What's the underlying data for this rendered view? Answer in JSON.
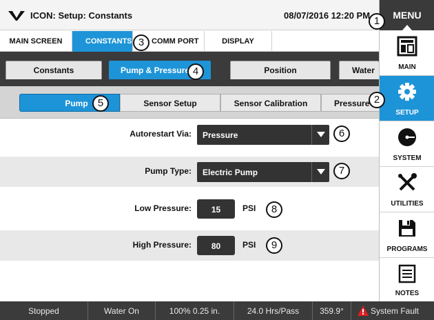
{
  "window": {
    "title": "ICON: Setup: Constants",
    "datetime": "08/07/2016 12:20 PM",
    "menu_label": "MENU"
  },
  "top_tabs": [
    {
      "label": "MAIN SCREEN",
      "active": false
    },
    {
      "label": "CONSTANTS",
      "active": true
    },
    {
      "label": "COMM PORT",
      "active": false
    },
    {
      "label": "DISPLAY",
      "active": false
    }
  ],
  "sub_tabs": [
    {
      "label": "Constants",
      "active": false
    },
    {
      "label": "Pump & Pressure",
      "active": true
    },
    {
      "label": "Position",
      "active": false
    },
    {
      "label": "Water",
      "active": false
    }
  ],
  "pills": [
    {
      "label": "Pump",
      "active": true
    },
    {
      "label": "Sensor Setup",
      "active": false
    },
    {
      "label": "Sensor Calibration",
      "active": false
    },
    {
      "label": "Pressure",
      "active": false
    }
  ],
  "form": {
    "autorestart": {
      "label": "Autorestart Via:",
      "value": "Pressure"
    },
    "pump_type": {
      "label": "Pump Type:",
      "value": "Electric Pump"
    },
    "low_pressure": {
      "label": "Low Pressure:",
      "value": "15",
      "unit": "PSI"
    },
    "high_pressure": {
      "label": "High Pressure:",
      "value": "80",
      "unit": "PSI"
    }
  },
  "sidebar": [
    {
      "label": "MAIN",
      "icon": "main-display-icon",
      "active": false
    },
    {
      "label": "SETUP",
      "icon": "gear-icon",
      "active": true
    },
    {
      "label": "SYSTEM",
      "icon": "system-dial-icon",
      "active": false
    },
    {
      "label": "UTILITIES",
      "icon": "tools-icon",
      "active": false
    },
    {
      "label": "PROGRAMS",
      "icon": "floppy-disk-icon",
      "active": false
    },
    {
      "label": "NOTES",
      "icon": "notes-icon",
      "active": false
    }
  ],
  "status_bar": {
    "state": "Stopped",
    "water": "Water On",
    "percent": "100% 0.25 in.",
    "hours": "24.0 Hrs/Pass",
    "angle": "359.9°",
    "fault": "System Fault"
  },
  "callouts": [
    "1",
    "2",
    "3",
    "4",
    "5",
    "6",
    "7",
    "8",
    "9"
  ],
  "colors": {
    "accent": "#1e94d8",
    "dark": "#3b3b3b",
    "fault": "#e02020"
  }
}
